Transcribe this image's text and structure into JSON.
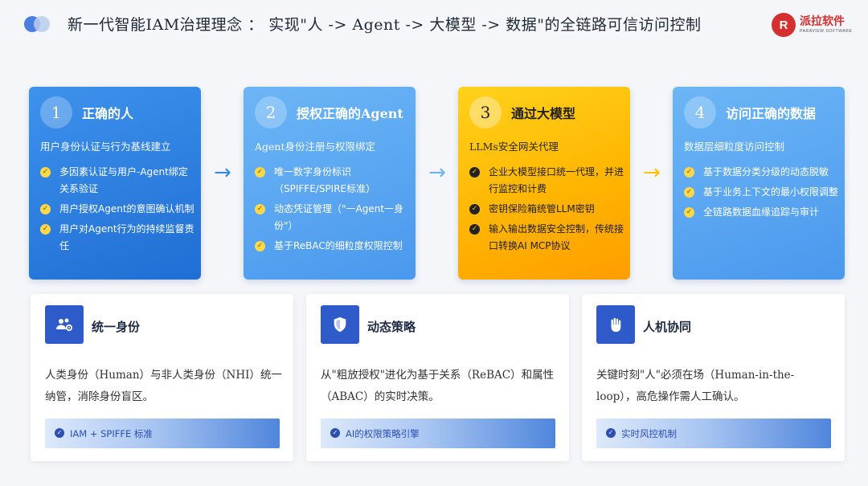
{
  "header": {
    "title": "新一代智能IAM治理理念 ： 实现\"人 -> Agent -> 大模型 -> 数据\"的全链路可信访问控制",
    "logo_mark": "R",
    "logo_text": "派拉软件",
    "logo_sub": "PARAVIEW SOFTWARE"
  },
  "steps": [
    {
      "num": "1",
      "title": "正确的人",
      "subtitle": "用户身份认证与行为基线建立",
      "items": [
        "多因素认证与用户-Agent绑定关系验证",
        "用户授权Agent的意图确认机制",
        "用户对Agent行为的持续监督责任"
      ]
    },
    {
      "num": "2",
      "title": "授权正确的Agent",
      "subtitle": "Agent身份注册与权限绑定",
      "items": [
        "唯一数字身份标识（SPIFFE/SPIRE标准）",
        "动态凭证管理（\"一Agent一身份\"）",
        "基于ReBAC的细粒度权限控制"
      ]
    },
    {
      "num": "3",
      "title": "通过大模型",
      "subtitle": "LLMs安全网关代理",
      "items": [
        "企业大模型接口统一代理，并进行监控和计费",
        "密钥保险箱统管LLM密钥",
        "输入输出数据安全控制，传统接口转换AI MCP协议"
      ]
    },
    {
      "num": "4",
      "title": "访问正确的数据",
      "subtitle": "数据层细粒度访问控制",
      "items": [
        "基于数据分类分级的动态脱敏",
        "基于业务上下文的最小权限调整",
        "全链路数据血缘追踪与审计"
      ]
    }
  ],
  "arrows": [
    "→",
    "→",
    "→"
  ],
  "features": [
    {
      "icon": "users-gear-icon",
      "title": "统一身份",
      "desc": "人类身份（Human）与非人类身份（NHI）统一纳管，消除身份盲区。",
      "badge": "IAM + SPIFFE 标准"
    },
    {
      "icon": "shield-icon",
      "title": "动态策略",
      "desc": "从\"粗放授权\"进化为基于关系（ReBAC）和属性（ABAC）的实时决策。",
      "badge": "AI的权限策略引擎"
    },
    {
      "icon": "hand-icon",
      "title": "人机协同",
      "desc": "关键时刻\"人\"必须在场（Human-in-the-loop），高危操作需人工确认。",
      "badge": "实时风控机制"
    }
  ],
  "colors": {
    "blue": "#1f6ed4",
    "light_blue": "#4a98ee",
    "yellow": "#ffb300",
    "icon_bg": "#2e5bc9",
    "logo_red": "#d62f2f"
  }
}
